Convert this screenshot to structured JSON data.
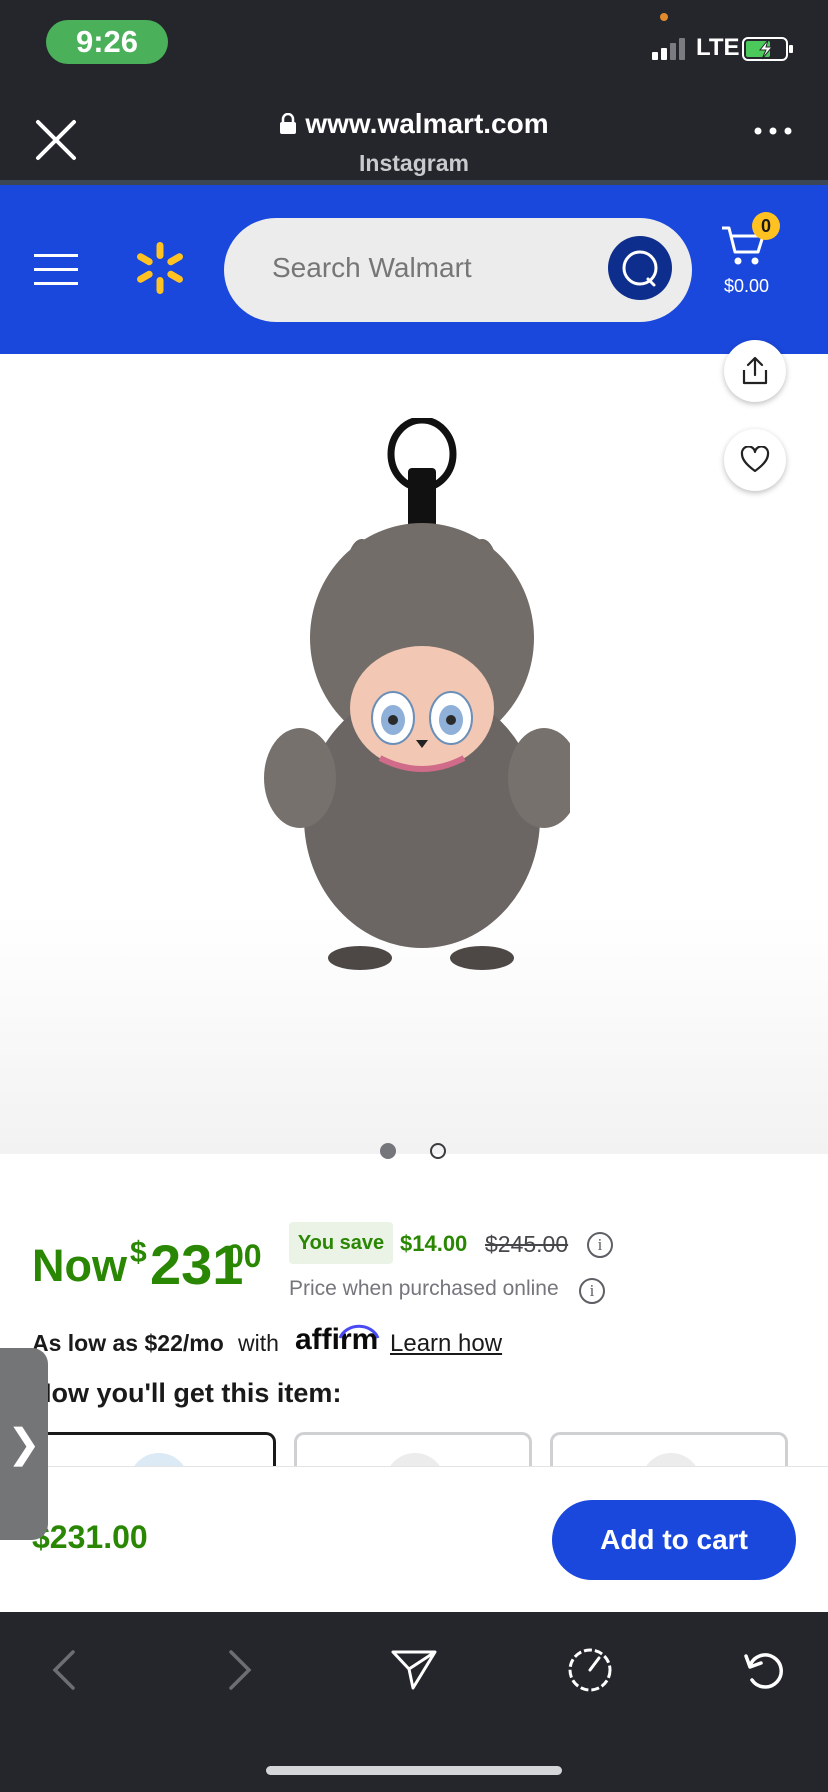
{
  "status_bar": {
    "time": "9:26",
    "network": "LTE"
  },
  "browser": {
    "url": "www.walmart.com",
    "source_app": "Instagram",
    "close_icon": "close-icon",
    "more_icon": "more-icon"
  },
  "header": {
    "search_placeholder": "Search Walmart",
    "cart_count": "0",
    "cart_total": "$0.00",
    "brand_color": "#1a48dd",
    "spark_color": "#ffc220"
  },
  "product": {
    "image_alt": "Plush monster keychain in gray fur",
    "carousel": {
      "count": 2,
      "active": 1
    }
  },
  "price": {
    "now_label": "Now",
    "currency": "$",
    "dollars": "231",
    "cents": "00",
    "you_save_label": "You save",
    "save_amount": "$14.00",
    "was_price": "$245.00",
    "price_note": "Price when purchased online"
  },
  "financing": {
    "as_low_as": "As low as $22/mo",
    "with": "with",
    "provider": "affirm",
    "learn_how": "Learn how"
  },
  "fulfillment": {
    "heading": "How you'll get this item:"
  },
  "sticky_bar": {
    "price": "$231.00",
    "add_to_cart": "Add to cart"
  },
  "side_tab": {
    "glyph": "❯"
  },
  "colors": {
    "accent_green": "#2a8703",
    "dark_bar": "#24262b"
  }
}
